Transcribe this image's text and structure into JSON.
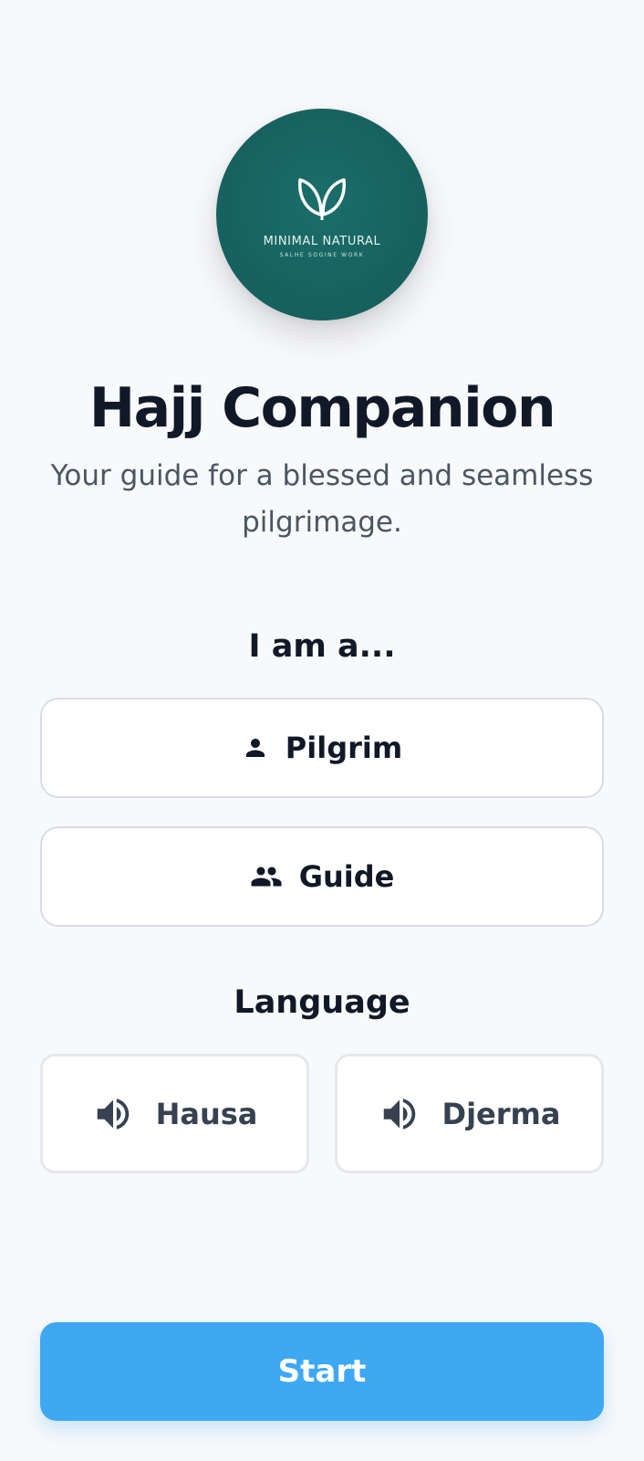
{
  "logo": {
    "title": "MINIMAL NATURAL",
    "subtitle": "SALHE SOGINE WORK",
    "icon": "leaf-icon",
    "color": "#17625f"
  },
  "header": {
    "title": "Hajj Companion",
    "tagline": "Your guide for a blessed and seamless pilgrimage."
  },
  "role": {
    "label": "I am a...",
    "options": [
      {
        "label": "Pilgrim",
        "icon": "person-icon"
      },
      {
        "label": "Guide",
        "icon": "group-icon"
      }
    ]
  },
  "language": {
    "label": "Language",
    "options": [
      {
        "label": "Hausa",
        "icon": "speaker-icon"
      },
      {
        "label": "Djerma",
        "icon": "speaker-icon"
      }
    ]
  },
  "start": {
    "label": "Start",
    "color": "#3ea8f2"
  }
}
